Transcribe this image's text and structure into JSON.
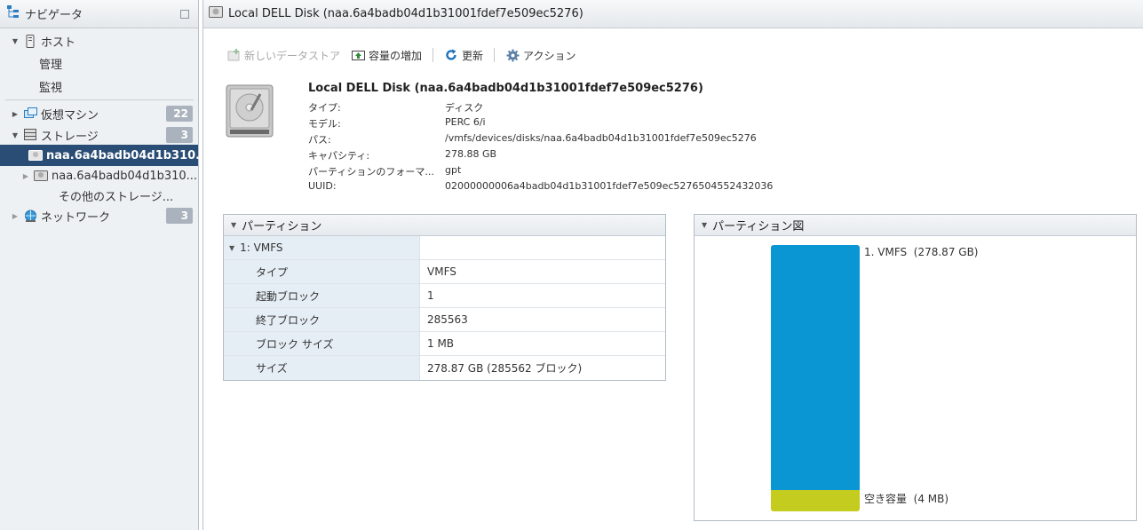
{
  "navigator": {
    "title": "ナビゲータ",
    "host": "ホスト",
    "host_manage": "管理",
    "host_monitor": "監視",
    "vms": "仮想マシン",
    "vms_count": "22",
    "storage": "ストレージ",
    "storage_count": "3",
    "disk1": "naa.6a4badb04d1b310...",
    "disk2": "naa.6a4badb04d1b310...",
    "other_storage": "その他のストレージ...",
    "network": "ネットワーク",
    "network_count": "3"
  },
  "main": {
    "header_title": "Local DELL Disk (naa.6a4badb04d1b31001fdef7e509ec5276)",
    "toolbar": {
      "new_datastore": "新しいデータストア",
      "increase_capacity": "容量の増加",
      "refresh": "更新",
      "actions": "アクション"
    },
    "detail": {
      "title": "Local DELL Disk (naa.6a4badb04d1b31001fdef7e509ec5276)",
      "fields": [
        {
          "label": "タイプ:",
          "value": "ディスク"
        },
        {
          "label": "モデル:",
          "value": "PERC 6/i"
        },
        {
          "label": "パス:",
          "value": "/vmfs/devices/disks/naa.6a4badb04d1b31001fdef7e509ec5276"
        },
        {
          "label": "キャパシティ:",
          "value": "278.88 GB"
        },
        {
          "label": "パーティションのフォーマ...",
          "value": "gpt"
        },
        {
          "label": "UUID:",
          "value": "02000000006a4badb04d1b31001fdef7e509ec5276504552432036"
        }
      ]
    },
    "partitions": {
      "title": "パーティション",
      "group": "1: VMFS",
      "rows": [
        {
          "label": "タイプ",
          "value": "VMFS"
        },
        {
          "label": "起動ブロック",
          "value": "1"
        },
        {
          "label": "終了ブロック",
          "value": "285563"
        },
        {
          "label": "ブロック サイズ",
          "value": "1 MB"
        },
        {
          "label": "サイズ",
          "value": "278.87 GB (285562 ブロック)"
        }
      ]
    },
    "partition_diagram": {
      "title": "パーティション図",
      "vmfs_label": "1. VMFS",
      "vmfs_size": "(278.87 GB)",
      "free_label": "空き容量",
      "free_size": "(4 MB)",
      "vmfs_color": "#0a95d3",
      "free_color": "#c3cc1f"
    }
  }
}
